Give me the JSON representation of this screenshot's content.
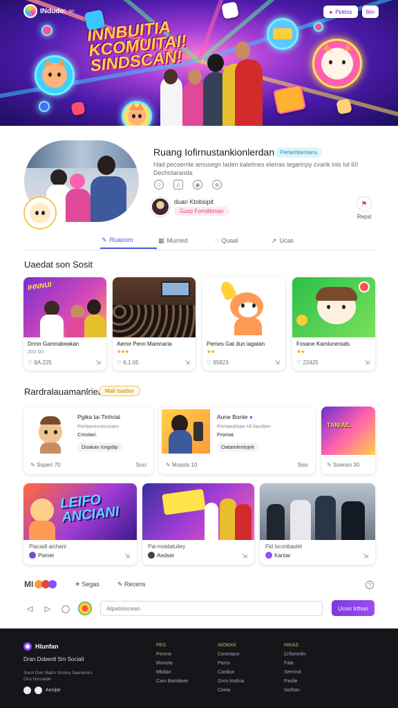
{
  "brand": {
    "name": "INdudo:",
    "name_suffix": "sn"
  },
  "hero": {
    "title_lines": [
      "INNBUITIA",
      "KCOMUITAI!",
      "SINDSCAN!"
    ],
    "action_primary": "Pᴇʀtos",
    "action_secondary": "Ikin"
  },
  "profile": {
    "name": "Ruang Iofirnustankionlerdan",
    "badge": "Pertambentans",
    "description": "Had pecoerrile amusegn laden kaletines elerras legarinpy cvarik inis lut 60 Dechotaranda",
    "host_name": "duan Ktobsipit",
    "host_tag": "Gusp Fomdibman",
    "report_label": "Repsl"
  },
  "tabs": [
    {
      "label": "Ruaoom",
      "icon": "edit-icon"
    },
    {
      "label": "Mumed",
      "icon": "grid-icon"
    },
    {
      "label": "Quaal",
      "icon": "chat-icon"
    },
    {
      "label": "Ucas",
      "icon": "send-icon"
    }
  ],
  "section_recent": {
    "title": "Uaedat son Sosit"
  },
  "recent_cards": [
    {
      "title": "Drmn Gamnabeakan",
      "meta": "200 00",
      "stars": "",
      "likes": "♡ 8A.225",
      "image": "party"
    },
    {
      "title": "Aeme Penn Mamnaria",
      "meta": "",
      "stars": "★★★",
      "likes": "♡ 6.1.05",
      "image": "crowd"
    },
    {
      "title": "Pemes Gat dun iagatan",
      "meta": "",
      "stars": "★★",
      "likes": "♡ 85823",
      "image": "fox"
    },
    {
      "title": "Fosane Kamlunenials",
      "meta": "",
      "stars": "★★",
      "likes": "♡ 22425",
      "image": "cat"
    }
  ],
  "section_recommended": {
    "title": "Rardralauamanlriea",
    "badge": "Mail tsarbor"
  },
  "rec_cards": [
    {
      "title": "Pgika lai Tinhrial",
      "sub": "Pertiacemetnciam",
      "sub2": "Cmotari.",
      "chip": "Doakan Iorgidip",
      "footer_left": "Sopert 70",
      "footer_right": "Soci"
    },
    {
      "title": "Aune Bonte",
      "sub": "Pentarahtae Hl ilandien",
      "sub2": "Fromat.",
      "chip": "Oatamlenlojek",
      "footer_left": "Mossts 10",
      "footer_right": "Sisn"
    },
    {
      "footer_left": "Soersio 30"
    }
  ],
  "bottom_cards": [
    {
      "title": "Piacadl aichani",
      "author": "Pomer",
      "image_text": "LEIFO ANCIANI"
    },
    {
      "title": "Pai moidatuiley",
      "author": "Aedser",
      "image_text": ""
    },
    {
      "title": "Fld isconbaslel",
      "author": "Kantar",
      "image_text": ""
    }
  ],
  "reactions": {
    "label_a": "MI",
    "label_b": "Segas",
    "label_c": "Recens"
  },
  "comment": {
    "placeholder": "Alpatoiscean",
    "send": "Ucon Irthun"
  },
  "footer": {
    "brand": "Hlunfan",
    "tagline": "Dran Dobentl Sm Socialt",
    "desc": "Sonn Dnrr Batrn Smrira Saenemrs Ons Hsroalde",
    "social_label": "Aeolpe",
    "columns": [
      {
        "heading": "FEG",
        "links": [
          "Pomne",
          "Moriota",
          "Mbdan",
          "Cam Bartidean"
        ]
      },
      {
        "heading": "AIOMXK",
        "links": [
          "Conmiace",
          "Parns",
          "Cardion",
          "Gnm Imdina",
          "Coeia"
        ]
      },
      {
        "heading": "NIKAS",
        "links": [
          "Crfionmlm",
          "Fala",
          "Sermnd",
          "Pasfie",
          "Sorfran"
        ]
      }
    ]
  },
  "colors": {
    "accent": "#4b56d6",
    "send": "#8a45ea",
    "star": "#f2a21b",
    "footer_bg": "#15151a"
  }
}
